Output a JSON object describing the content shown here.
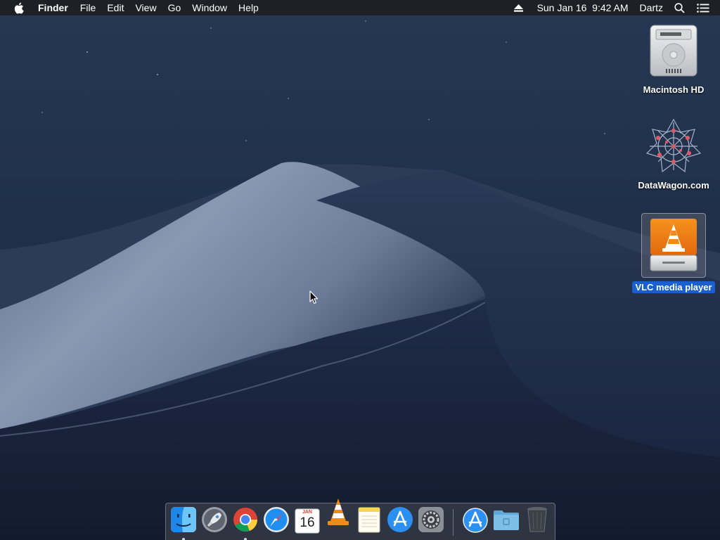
{
  "menubar": {
    "apple_icon": "apple-logo-icon",
    "app_name": "Finder",
    "menus": [
      "File",
      "Edit",
      "View",
      "Go",
      "Window",
      "Help"
    ],
    "eject_icon": "eject-icon",
    "datetime": "Sun Jan 16  9:42 AM",
    "user": "Dartz",
    "search_icon": "spotlight-search-icon",
    "notification_icon": "notification-center-icon"
  },
  "desktop": {
    "icons": [
      {
        "label": "Macintosh HD",
        "icon": "hard-drive-icon",
        "selected": false
      },
      {
        "label": "DataWagon.com",
        "icon": "datawagon-network-icon",
        "selected": false
      },
      {
        "label": "VLC media player",
        "icon": "vlc-disk-image-icon",
        "selected": true
      }
    ]
  },
  "dock": {
    "items": [
      {
        "name": "Finder",
        "icon": "finder-icon",
        "running": true
      },
      {
        "name": "Launchpad",
        "icon": "launchpad-icon",
        "running": false
      },
      {
        "name": "Google Chrome",
        "icon": "chrome-icon",
        "running": true
      },
      {
        "name": "Safari",
        "icon": "safari-icon",
        "running": false
      },
      {
        "name": "Calendar",
        "icon": "calendar-icon",
        "running": false,
        "month": "JAN",
        "day": "16"
      },
      {
        "name": "VLC",
        "icon": "vlc-icon",
        "running": false
      },
      {
        "name": "Notes",
        "icon": "notes-icon",
        "running": false
      },
      {
        "name": "App Store",
        "icon": "app-store-icon",
        "running": false
      },
      {
        "name": "System Preferences",
        "icon": "system-preferences-icon",
        "running": false
      },
      {
        "name": "Applications",
        "icon": "applications-stack-icon",
        "running": false
      },
      {
        "name": "Downloads",
        "icon": "folder-icon",
        "running": false
      },
      {
        "name": "Trash",
        "icon": "trash-icon",
        "running": false
      }
    ]
  },
  "colors": {
    "menubar_bg": "#1e1e22",
    "selection_blue": "#1a5fd0",
    "wallpaper_sky": "#1f2e46"
  }
}
